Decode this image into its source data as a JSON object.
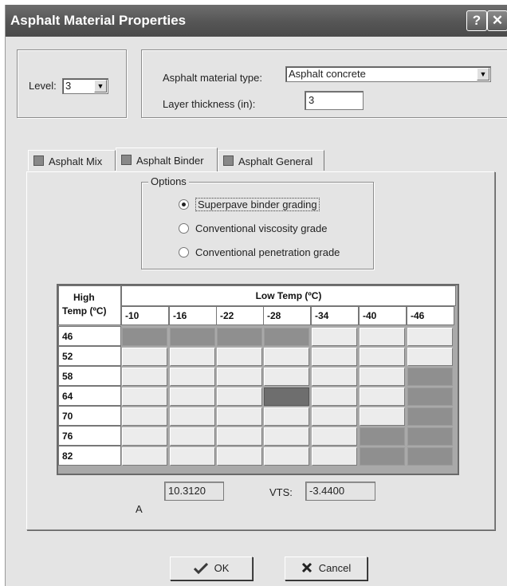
{
  "window": {
    "title": "Asphalt Material Properties",
    "help_glyph": "?",
    "close_glyph": "✕"
  },
  "level": {
    "label": "Level:",
    "value": "3"
  },
  "material": {
    "type_label": "Asphalt material type:",
    "type_value": "Asphalt concrete",
    "thickness_label": "Layer thickness (in):",
    "thickness_value": "3"
  },
  "tabs": [
    {
      "label": "Asphalt Mix",
      "active": false
    },
    {
      "label": "Asphalt Binder",
      "active": true
    },
    {
      "label": "Asphalt General",
      "active": false
    }
  ],
  "options": {
    "legend": "Options",
    "items": [
      {
        "label": "Superpave binder grading",
        "selected": true
      },
      {
        "label": "Conventional viscosity grade",
        "selected": false
      },
      {
        "label": "Conventional penetration grade",
        "selected": false
      }
    ]
  },
  "grid": {
    "corner_label_1": "High",
    "corner_label_2": "Temp (ºC)",
    "low_temp_header": "Low Temp (ºC)",
    "low_temps": [
      "-10",
      "-16",
      "-22",
      "-28",
      "-34",
      "-40",
      "-46"
    ],
    "high_temps": [
      "46",
      "52",
      "58",
      "64",
      "70",
      "76",
      "82"
    ],
    "cell_state": [
      [
        1,
        1,
        1,
        1,
        0,
        0,
        0
      ],
      [
        0,
        0,
        0,
        0,
        0,
        0,
        0
      ],
      [
        0,
        0,
        0,
        0,
        0,
        0,
        1
      ],
      [
        0,
        0,
        0,
        2,
        0,
        0,
        1
      ],
      [
        0,
        0,
        0,
        0,
        0,
        0,
        1
      ],
      [
        0,
        0,
        0,
        0,
        0,
        1,
        1
      ],
      [
        0,
        0,
        0,
        0,
        0,
        1,
        1
      ]
    ]
  },
  "coefficients": {
    "a_label": "A",
    "a_value": "10.3120",
    "vts_label": "VTS:",
    "vts_value": "-3.4400"
  },
  "buttons": {
    "ok": {
      "label": "OK",
      "icon": "checkmark-icon"
    },
    "cancel": {
      "label": "Cancel",
      "icon": "x-icon"
    }
  },
  "colors": {
    "title_bar": "#555555",
    "cell_selected": "#8f8f8f",
    "cell_current": "#6e6e6e"
  }
}
